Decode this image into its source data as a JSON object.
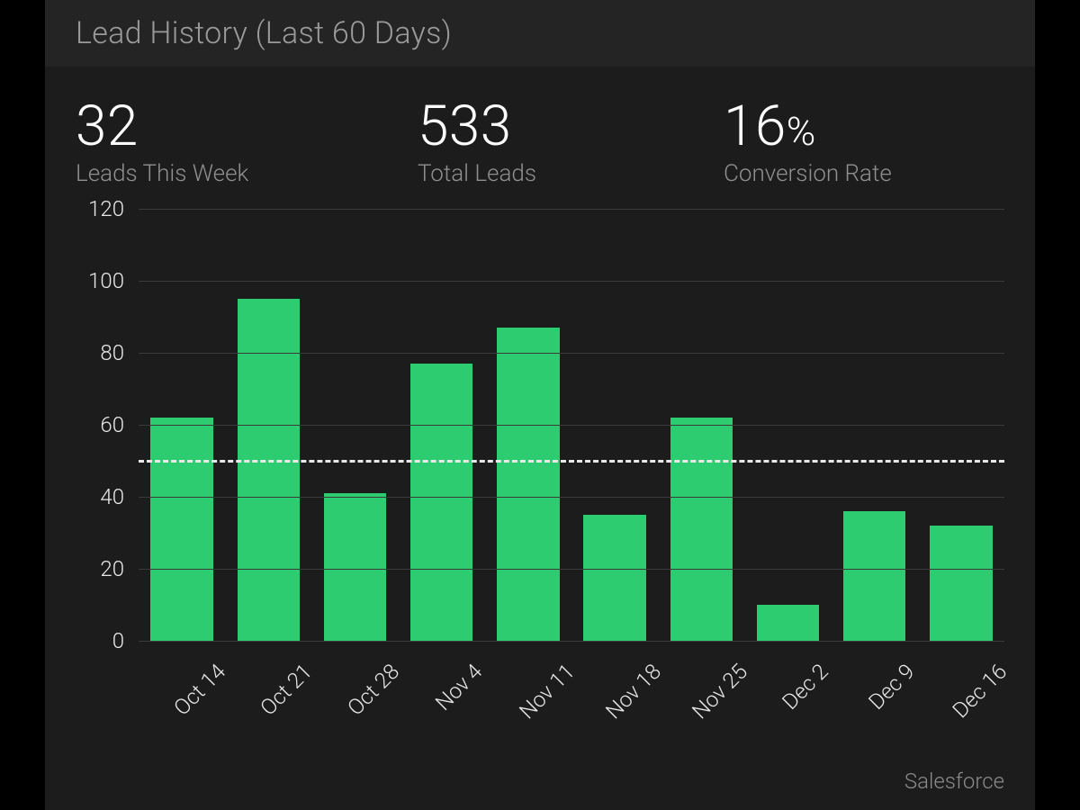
{
  "title": "Lead History (Last 60 Days)",
  "metrics": [
    {
      "value": "32",
      "label": "Leads This Week",
      "has_percent": false
    },
    {
      "value": "533",
      "label": "Total Leads",
      "has_percent": false
    },
    {
      "value": "16",
      "label": "Conversion Rate",
      "has_percent": true
    }
  ],
  "source": "Salesforce",
  "colors": {
    "bar": "#2ecc71",
    "panel": "#1c1c1c",
    "titlebar": "#242424"
  },
  "chart_data": {
    "type": "bar",
    "categories": [
      "Oct 14",
      "Oct 21",
      "Oct 28",
      "Nov 4",
      "Nov 11",
      "Nov 18",
      "Nov 25",
      "Dec 2",
      "Dec 9",
      "Dec 16"
    ],
    "values": [
      62,
      95,
      41,
      77,
      87,
      35,
      62,
      10,
      36,
      32
    ],
    "ylim": [
      0,
      120
    ],
    "yticks": [
      0,
      20,
      40,
      60,
      80,
      100,
      120
    ],
    "reference_line": 50,
    "title": "Lead History (Last 60 Days)",
    "xlabel": "",
    "ylabel": ""
  }
}
